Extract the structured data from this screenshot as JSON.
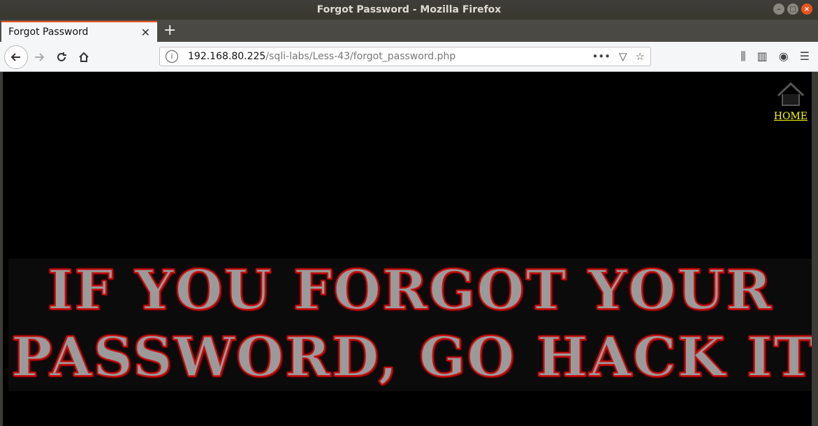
{
  "window": {
    "title": "Forgot Password - Mozilla Firefox"
  },
  "tabs": [
    {
      "label": "Forgot Password"
    }
  ],
  "url": {
    "host": "192.168.80.225",
    "path": "/sqli-labs/Less-43/forgot_password.php"
  },
  "page": {
    "home_label": "HOME",
    "banner_line1": "IF YOU FORGOT YOUR",
    "banner_line2": "PASSWORD, GO HACK IT"
  },
  "colors": {
    "accent": "#e95420",
    "link": "#ffff00",
    "banner_outline": "#c81010"
  }
}
